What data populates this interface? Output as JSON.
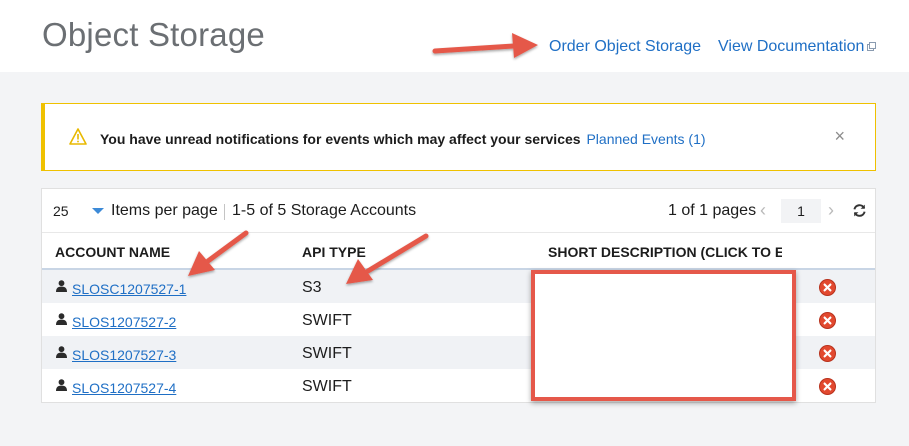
{
  "page": {
    "title": "Object Storage",
    "links": {
      "order": "Order Object Storage",
      "docs": "View Documentation"
    }
  },
  "notification": {
    "message": "You have unread notifications for events which may affect your services",
    "link": "Planned Events (1)",
    "close": "×",
    "icon": "warning-icon"
  },
  "toolbar": {
    "per_page_value": "25",
    "per_page_label": "Items per page",
    "count": "1-5 of 5 Storage Accounts",
    "pages": "1 of 1 pages",
    "current_page": "1",
    "prev": "‹",
    "next": "›"
  },
  "table": {
    "columns": [
      "ACCOUNT NAME",
      "API TYPE",
      "SHORT DESCRIPTION (CLICK TO EI"
    ],
    "rows": [
      {
        "account": "SLOSC1207527-1",
        "api": "S3"
      },
      {
        "account": "SLOS1207527-2",
        "api": "SWIFT"
      },
      {
        "account": "SLOS1207527-3",
        "api": "SWIFT"
      },
      {
        "account": "SLOS1207527-4",
        "api": "SWIFT"
      }
    ]
  },
  "colors": {
    "link": "#1f6fc5",
    "warning": "#efc100",
    "annotation": "#e5584a",
    "delete": "#e2492f"
  }
}
